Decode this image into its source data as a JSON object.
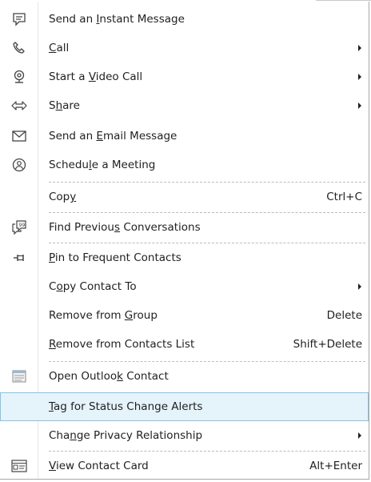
{
  "menu": {
    "items": [
      {
        "pre": "Send an ",
        "key": "I",
        "post": "nstant Message",
        "shortcut": "",
        "submenu": false,
        "icon": "instant-message-icon"
      },
      {
        "pre": "",
        "key": "C",
        "post": "all",
        "shortcut": "",
        "submenu": true,
        "icon": "phone-icon"
      },
      {
        "pre": "Start a ",
        "key": "V",
        "post": "ideo Call",
        "shortcut": "",
        "submenu": true,
        "icon": "webcam-icon"
      },
      {
        "pre": "S",
        "key": "h",
        "post": "are",
        "shortcut": "",
        "submenu": true,
        "icon": "share-icon"
      },
      {
        "pre": "Send an ",
        "key": "E",
        "post": "mail Message",
        "shortcut": "",
        "submenu": false,
        "icon": "envelope-icon"
      },
      {
        "pre": "Schedu",
        "key": "l",
        "post": "e a Meeting",
        "shortcut": "",
        "submenu": false,
        "icon": "meeting-icon"
      },
      {
        "pre": "Cop",
        "key": "y",
        "post": "",
        "shortcut": "Ctrl+C",
        "submenu": false,
        "icon": ""
      },
      {
        "pre": "Find Previou",
        "key": "s",
        "post": " Conversations",
        "shortcut": "",
        "submenu": false,
        "icon": "conversation-history-icon"
      },
      {
        "pre": "",
        "key": "P",
        "post": "in to Frequent Contacts",
        "shortcut": "",
        "submenu": false,
        "icon": "pin-icon"
      },
      {
        "pre": "C",
        "key": "o",
        "post": "py Contact To",
        "shortcut": "",
        "submenu": true,
        "icon": ""
      },
      {
        "pre": "Remove from ",
        "key": "G",
        "post": "roup",
        "shortcut": "Delete",
        "submenu": false,
        "icon": ""
      },
      {
        "pre": "",
        "key": "R",
        "post": "emove from Contacts List",
        "shortcut": "Shift+Delete",
        "submenu": false,
        "icon": ""
      },
      {
        "pre": "Open Outloo",
        "key": "k",
        "post": " Contact",
        "shortcut": "",
        "submenu": false,
        "icon": "outlook-contact-icon"
      },
      {
        "pre": "",
        "key": "T",
        "post": "ag for Status Change Alerts",
        "shortcut": "",
        "submenu": false,
        "icon": "",
        "highlighted": true
      },
      {
        "pre": "Cha",
        "key": "n",
        "post": "ge Privacy Relationship",
        "shortcut": "",
        "submenu": true,
        "icon": ""
      },
      {
        "pre": "",
        "key": "V",
        "post": "iew Contact Card",
        "shortcut": "Alt+Enter",
        "submenu": false,
        "icon": "contact-card-icon"
      }
    ]
  }
}
